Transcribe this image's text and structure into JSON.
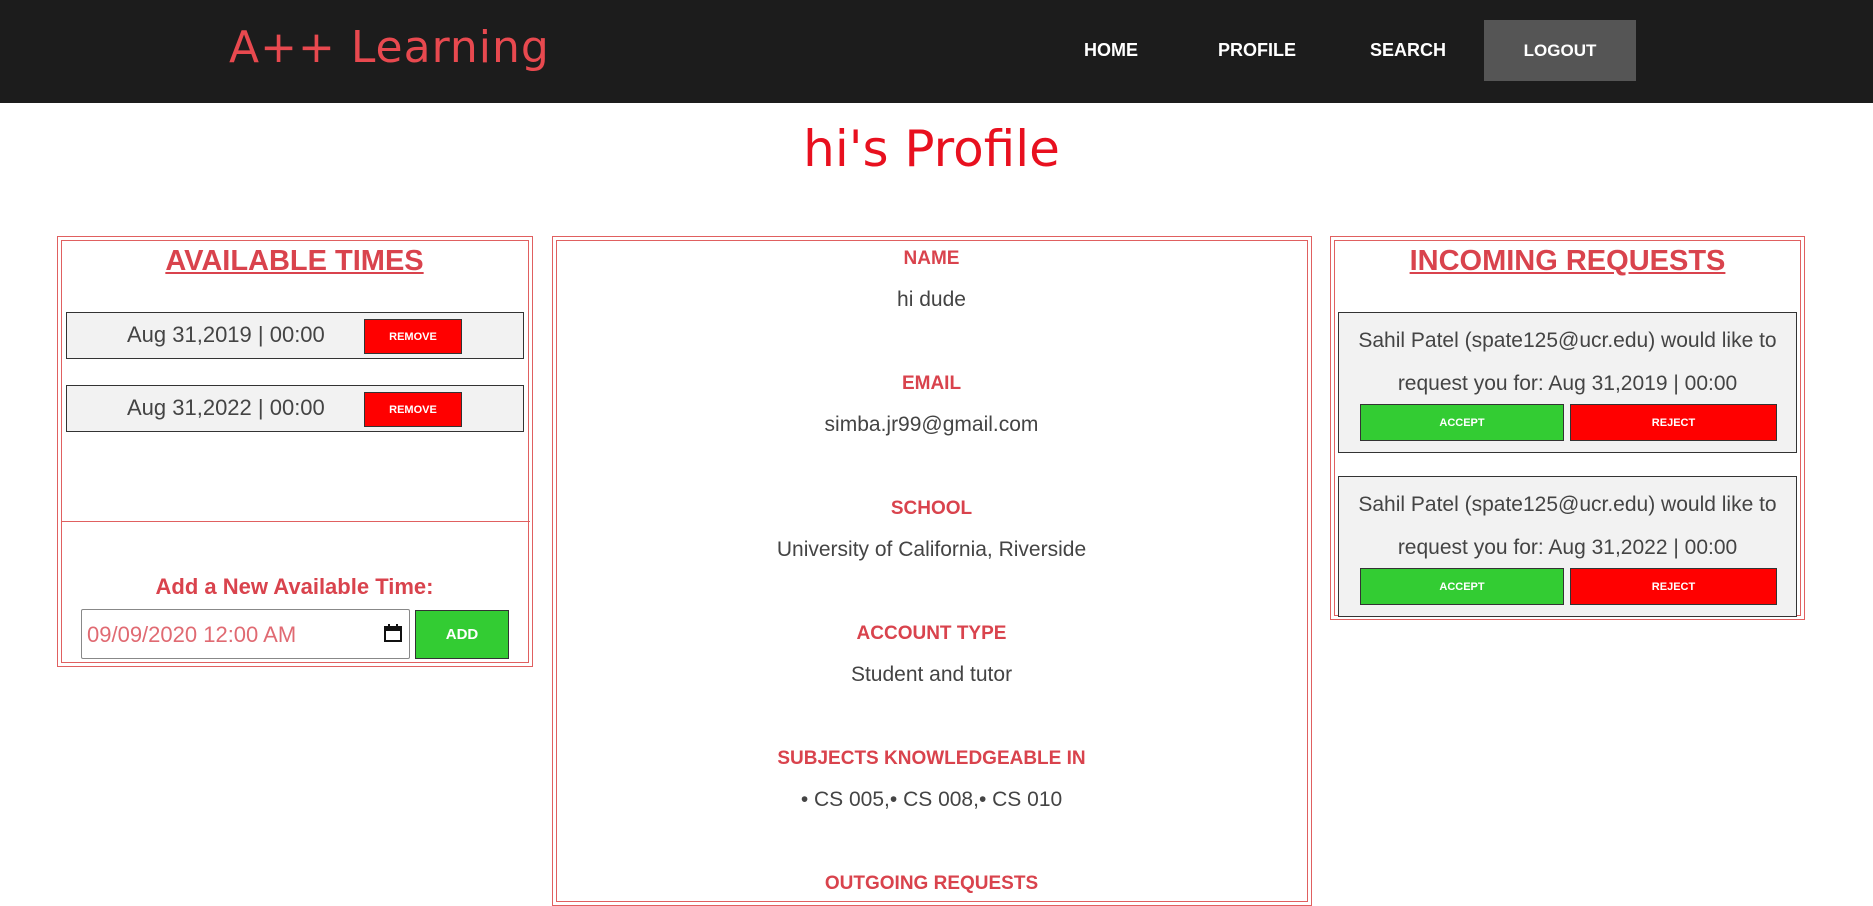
{
  "navbar": {
    "brand": "A++ Learning",
    "links": [
      "HOME",
      "PROFILE",
      "SEARCH"
    ],
    "logout": "LOGOUT"
  },
  "page_title": "hi's Profile",
  "available_times": {
    "heading": "AVAILABLE TIMES",
    "items": [
      {
        "time": "Aug 31,2019 | 00:00",
        "remove_label": "REMOVE"
      },
      {
        "time": "Aug 31,2022 | 00:00",
        "remove_label": "REMOVE"
      }
    ],
    "add_label": "Add a New Available Time:",
    "input_value": "09/09/2020 12:00 AM",
    "add_button": "ADD"
  },
  "profile": {
    "name_label": "NAME",
    "name": "hi dude",
    "email_label": "EMAIL",
    "email": "simba.jr99@gmail.com",
    "school_label": "SCHOOL",
    "school": "University of California, Riverside",
    "account_type_label": "ACCOUNT TYPE",
    "account_type": "Student and tutor",
    "subjects_label": "SUBJECTS KNOWLEDGEABLE IN",
    "subjects": "• CS 005,• CS 008,• CS 010",
    "outgoing_label": "OUTGOING REQUESTS"
  },
  "incoming_requests": {
    "heading": "INCOMING REQUESTS",
    "items": [
      {
        "line1": "Sahil Patel (spate125@ucr.edu) would like to",
        "line2": "request you for: Aug 31,2019 | 00:00",
        "accept": "ACCEPT",
        "reject": "REJECT"
      },
      {
        "line1": "Sahil Patel (spate125@ucr.edu) would like to",
        "line2": "request you for: Aug 31,2022 | 00:00",
        "accept": "ACCEPT",
        "reject": "REJECT"
      }
    ]
  }
}
